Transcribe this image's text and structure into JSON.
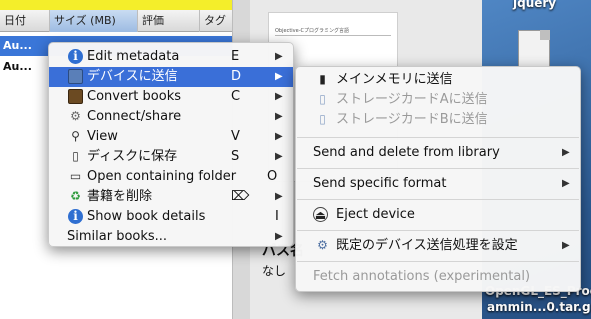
{
  "library_table": {
    "columns": [
      "日付",
      "サイズ (MB)",
      "評価",
      "タグ"
    ],
    "rows": [
      "Au...",
      "Au..."
    ]
  },
  "preview": {
    "page_title": "Objective-Cプログラミング言語",
    "heading_partial": "パス名",
    "value": "なし"
  },
  "desktop": {
    "top_label": "jquery",
    "file_label_1": "OpenGL_ES_Progr",
    "file_label_2": "ammin...0.tar.gz"
  },
  "main_menu": {
    "items": [
      {
        "label": "Edit metadata",
        "shortcut": "E",
        "icon": "info-icon",
        "has_submenu": true
      },
      {
        "label": "デバイスに送信",
        "shortcut": "D",
        "icon": "device-icon",
        "has_submenu": true,
        "highlighted": true
      },
      {
        "label": "Convert books",
        "shortcut": "C",
        "icon": "book-icon",
        "has_submenu": true
      },
      {
        "label": "Connect/share",
        "shortcut": "",
        "icon": "connect-icon",
        "has_submenu": true
      },
      {
        "label": "View",
        "shortcut": "V",
        "icon": "magnifier-icon",
        "has_submenu": true
      },
      {
        "label": "ディスクに保存",
        "shortcut": "S",
        "icon": "disk-icon",
        "has_submenu": true
      },
      {
        "label": "Open containing folder",
        "shortcut": "O",
        "icon": "",
        "has_submenu": false
      },
      {
        "label": "書籍を削除",
        "shortcut": "⌦",
        "icon": "recycle-icon",
        "has_submenu": true
      },
      {
        "label": "Show book details",
        "shortcut": "I",
        "icon": "info-icon",
        "has_submenu": false
      },
      {
        "label": "Similar books...",
        "shortcut": "",
        "icon": "",
        "has_submenu": true
      }
    ]
  },
  "submenu": {
    "items": [
      {
        "label": "メインメモリに送信",
        "icon": "phone-icon",
        "enabled": true,
        "has_submenu": false
      },
      {
        "label": "ストレージカードAに送信",
        "icon": "card-icon",
        "enabled": false,
        "has_submenu": false
      },
      {
        "label": "ストレージカードBに送信",
        "icon": "card-icon",
        "enabled": false,
        "has_submenu": false
      },
      {
        "label": "Send and delete from library",
        "icon": "",
        "enabled": true,
        "has_submenu": true
      },
      {
        "label": "Send specific format",
        "icon": "",
        "enabled": true,
        "has_submenu": true
      },
      {
        "label": "Eject device",
        "icon": "eject-icon",
        "enabled": true,
        "has_submenu": false
      },
      {
        "label": "既定のデバイス送信処理を設定",
        "icon": "gear-icon",
        "enabled": true,
        "has_submenu": true
      },
      {
        "label": "Fetch annotations (experimental)",
        "icon": "",
        "enabled": false,
        "has_submenu": false
      }
    ]
  },
  "colors": {
    "highlight": "#3a6fd8",
    "selected_row": "#3a76d8",
    "yellow_bar": "#f4ee2a",
    "desktop": "#3b6aa3"
  }
}
